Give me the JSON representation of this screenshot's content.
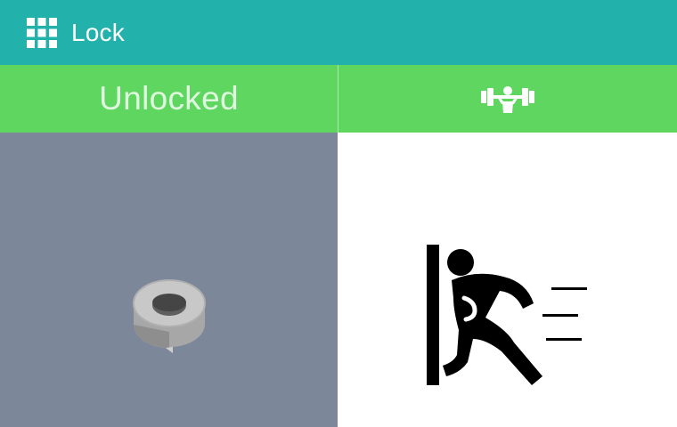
{
  "header": {
    "title": "Lock",
    "menu_icon": "grid-icon",
    "color": "#22b1ab"
  },
  "status_bar": {
    "state_label": "Unlocked",
    "action_icon": "weightlifter-icon",
    "color": "#5fd65f"
  },
  "panels": {
    "left": {
      "icon": "tape-ring-icon",
      "background": "#7c8799"
    },
    "right": {
      "icon": "person-escaping-door-icon",
      "background": "#ffffff"
    }
  }
}
